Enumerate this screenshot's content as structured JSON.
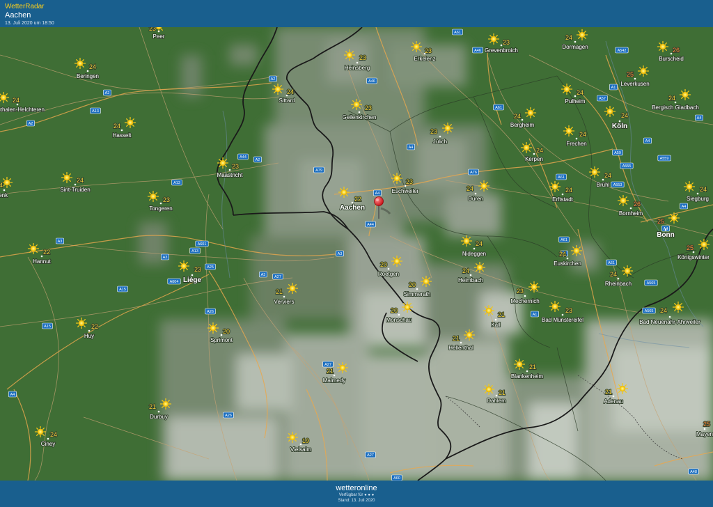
{
  "header": {
    "brand": "WetterRadar",
    "location": "Aachen",
    "timestamp": "13. Juli 2020 um 18:50"
  },
  "footer": {
    "logo": "wetteronline",
    "availability": "Verfügbar für ● ● ●",
    "status": "Stand: 13. Juli 2020"
  },
  "weather_icon": "sun-icon",
  "pin_icon": "map-pin-icon",
  "colors": {
    "header": "#195f8e",
    "temperature": "#f3d03a",
    "hot_temperature": "#ff8a3a",
    "pin": "#e3131c"
  },
  "places": [
    {
      "name": "Peer",
      "temp": "23",
      "city": false
    },
    {
      "name": "Heinsberg",
      "temp": "23",
      "city": false
    },
    {
      "name": "Erkelenz",
      "temp": "23",
      "city": false
    },
    {
      "name": "Grevenbroich",
      "temp": "23",
      "city": false
    },
    {
      "name": "Dormagen",
      "temp": "24",
      "city": false
    },
    {
      "name": "Burscheid",
      "temp": "26",
      "city": false
    },
    {
      "name": "Beringen",
      "temp": "24",
      "city": false
    },
    {
      "name": "Sittard",
      "temp": "24",
      "city": false
    },
    {
      "name": "Leverkusen",
      "temp": "25",
      "city": false
    },
    {
      "name": "Pulheim",
      "temp": "24",
      "city": false
    },
    {
      "name": "Bergisch Gladbach",
      "temp": "24",
      "city": false
    },
    {
      "name": "Houthalen-Helchteren",
      "temp": "24",
      "city": false
    },
    {
      "name": "Geilenkirchen",
      "temp": "23",
      "city": false
    },
    {
      "name": "Köln",
      "temp": "24",
      "city": true
    },
    {
      "name": "Hasselt",
      "temp": "24",
      "city": false
    },
    {
      "name": "Jülich",
      "temp": "23",
      "city": false
    },
    {
      "name": "Bergheim",
      "temp": "24",
      "city": false
    },
    {
      "name": "Frechen",
      "temp": "24",
      "city": false
    },
    {
      "name": "Maastricht",
      "temp": "23",
      "city": false
    },
    {
      "name": "Kerpen",
      "temp": "24",
      "city": false
    },
    {
      "name": "Sint-Truiden",
      "temp": "24",
      "city": false
    },
    {
      "name": "Genk",
      "temp": "24",
      "city": false
    },
    {
      "name": "Eschweiler",
      "temp": "23",
      "city": false
    },
    {
      "name": "Düren",
      "temp": "24",
      "city": false
    },
    {
      "name": "Brühl",
      "temp": "24",
      "city": false
    },
    {
      "name": "Siegburg",
      "temp": "24",
      "city": false
    },
    {
      "name": "Erftstadt",
      "temp": "24",
      "city": false
    },
    {
      "name": "Aachen",
      "temp": "22",
      "city": true
    },
    {
      "name": "Tongeren",
      "temp": "23",
      "city": false
    },
    {
      "name": "Bornheim",
      "temp": "26",
      "city": false
    },
    {
      "name": "Bonn",
      "temp": "25",
      "city": true
    },
    {
      "name": "Nideggen",
      "temp": "24",
      "city": false
    },
    {
      "name": "Euskirchen",
      "temp": "24",
      "city": false
    },
    {
      "name": "Königswinter",
      "temp": "25",
      "city": false
    },
    {
      "name": "Hannut",
      "temp": "22",
      "city": false
    },
    {
      "name": "Liège",
      "temp": "23",
      "city": true
    },
    {
      "name": "Heimbach",
      "temp": "24",
      "city": false
    },
    {
      "name": "Roetgen",
      "temp": "20",
      "city": false
    },
    {
      "name": "Rheinbach",
      "temp": "24",
      "city": false
    },
    {
      "name": "Simmerath",
      "temp": "20",
      "city": false
    },
    {
      "name": "Verviers",
      "temp": "21",
      "city": false
    },
    {
      "name": "Mechernich",
      "temp": "23",
      "city": false
    },
    {
      "name": "Bad Münstereifel",
      "temp": "23",
      "city": false
    },
    {
      "name": "Bad Neuenahr-Ahrweiler",
      "temp": "24",
      "city": false
    },
    {
      "name": "Monschau",
      "temp": "20",
      "city": false
    },
    {
      "name": "Kall",
      "temp": "21",
      "city": false
    },
    {
      "name": "Huy",
      "temp": "22",
      "city": false
    },
    {
      "name": "Sprimont",
      "temp": "20",
      "city": false
    },
    {
      "name": "Hellenthal",
      "temp": "21",
      "city": false
    },
    {
      "name": "Blankenheim",
      "temp": "21",
      "city": false
    },
    {
      "name": "Malmedy",
      "temp": "21",
      "city": false
    },
    {
      "name": "Dahlem",
      "temp": "21",
      "city": false
    },
    {
      "name": "Adenau",
      "temp": "21",
      "city": false
    },
    {
      "name": "Durbuy",
      "temp": "21",
      "city": false
    },
    {
      "name": "Ciney",
      "temp": "24",
      "city": false
    },
    {
      "name": "Vielsalm",
      "temp": "19",
      "city": false
    },
    {
      "name": "Mayen",
      "temp": "25",
      "city": false
    }
  ],
  "roads": [
    "A61",
    "A46",
    "A542",
    "A2",
    "A46",
    "A1",
    "A57",
    "A2",
    "A13",
    "A61",
    "A4",
    "A2",
    "A4",
    "A44",
    "A2",
    "A79",
    "A76",
    "A4",
    "A559",
    "A59",
    "A4",
    "A13",
    "A4",
    "A61",
    "A555",
    "A553",
    "A4",
    "A3",
    "A601",
    "A13",
    "A3",
    "A25",
    "A3",
    "A565",
    "A44",
    "A3",
    "A27",
    "A1",
    "A61",
    "A604",
    "A15",
    "A26",
    "A565",
    "A15",
    "A61",
    "A1",
    "A27",
    "A26",
    "A4",
    "A27",
    "A60",
    "A48"
  ]
}
